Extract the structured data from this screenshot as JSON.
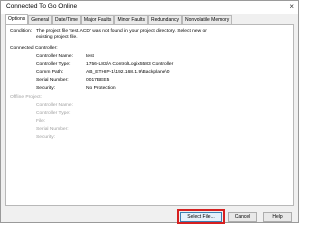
{
  "window": {
    "title": "Connected To Go Online",
    "close_glyph": "×"
  },
  "tabs": [
    {
      "label": "Options",
      "active": true
    },
    {
      "label": "General"
    },
    {
      "label": "Date/Time"
    },
    {
      "label": "Major Faults"
    },
    {
      "label": "Minor Faults"
    },
    {
      "label": "Redundancy"
    },
    {
      "label": "Nonvolatile Memory"
    }
  ],
  "condition": {
    "label": "Condition:",
    "line1": "The project file 'test.ACD' was not found in your project directory. Select new or",
    "line2": "existing project file."
  },
  "connected_controller": {
    "heading": "Connected Controller:",
    "fields": [
      {
        "label": "Controller Name:",
        "value": "test"
      },
      {
        "label": "Controller Type:",
        "value": "1756-L83/A ControlLogix5583 Controller"
      },
      {
        "label": "Comm Path:",
        "value": "AB_ETHIP-1\\192.168.1.9\\Backplane\\0"
      },
      {
        "label": "Serial Number:",
        "value": "0017BEE5"
      },
      {
        "label": "Security:",
        "value": "No Protection"
      }
    ]
  },
  "offline_project": {
    "heading": "Offline Project:",
    "fields": [
      {
        "label": "Controller Name:"
      },
      {
        "label": "Controller Type:"
      },
      {
        "label": "File:"
      },
      {
        "label": "Serial Number:"
      },
      {
        "label": "Security:"
      }
    ]
  },
  "buttons": {
    "select_file": "Select File...",
    "cancel": "Cancel",
    "help": "Help"
  },
  "colors": {
    "highlight": "#d62020",
    "panel_bg": "#ffffff",
    "dialog_bg": "#f0f0f0"
  }
}
